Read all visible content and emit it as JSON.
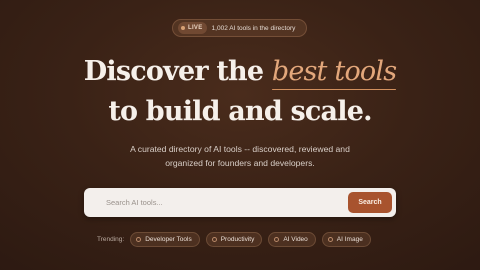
{
  "badge": {
    "live_label": "LIVE",
    "text": "1,002 AI tools in the directory"
  },
  "hero": {
    "line1_prefix": "Discover the ",
    "line1_accent": "best tools",
    "line2": "to build and scale."
  },
  "subtitle": {
    "line1": "A curated directory of AI tools -- discovered, reviewed and",
    "line2": "organized for founders and developers."
  },
  "search": {
    "placeholder": "Search AI tools...",
    "button_label": "Search"
  },
  "trending": {
    "label": "Trending:",
    "chips": [
      {
        "label": "Developer Tools",
        "icon": "code-icon"
      },
      {
        "label": "Productivity",
        "icon": "bolt-icon"
      },
      {
        "label": "AI Video",
        "icon": "video-icon"
      },
      {
        "label": "AI Image",
        "icon": "image-icon"
      }
    ]
  },
  "colors": {
    "background": "#3a2216",
    "accent": "#e3a77b",
    "button": "#a8532e"
  }
}
